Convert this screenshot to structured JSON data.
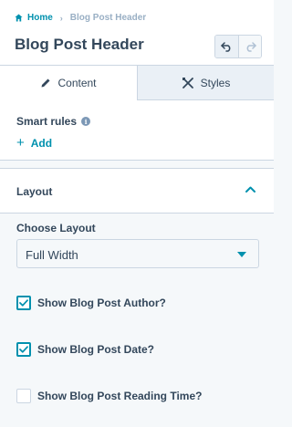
{
  "breadcrumb": {
    "home_label": "Home",
    "separator": "›",
    "current": "Blog Post Header"
  },
  "title": "Blog Post Header",
  "toolbar": {
    "undo_icon": "undo-icon",
    "redo_icon": "redo-icon"
  },
  "tabs": [
    {
      "label": "Content",
      "icon": "pencil-icon",
      "active": true
    },
    {
      "label": "Styles",
      "icon": "styles-tools-icon",
      "active": false
    }
  ],
  "smart_rules": {
    "label": "Smart rules",
    "info_icon": "info-icon",
    "add_label": "Add"
  },
  "layout_section": {
    "title": "Layout",
    "expanded": true,
    "choose_layout_label": "Choose Layout",
    "selected_layout": "Full Width",
    "options": [
      {
        "label": "Show Blog Post Author?",
        "checked": true
      },
      {
        "label": "Show Blog Post Date?",
        "checked": true
      },
      {
        "label": "Show Blog Post Reading Time?",
        "checked": false
      }
    ]
  },
  "colors": {
    "accent": "#0091ae",
    "text": "#33475b",
    "muted": "#99afc4",
    "border": "#cbd6e2",
    "panel_bg": "#f5f8fa"
  }
}
